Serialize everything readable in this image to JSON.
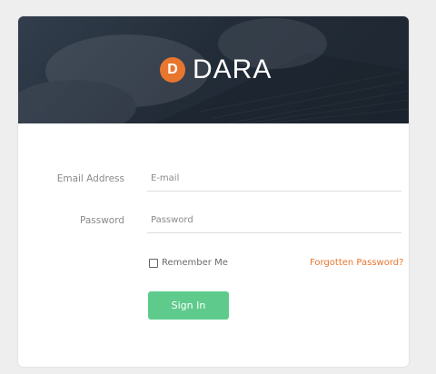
{
  "brand": {
    "logo_letter": "D",
    "name": "DARA",
    "accent": "#e8762f"
  },
  "form": {
    "email_label": "Email Address",
    "email_placeholder": "E-mail",
    "password_label": "Password",
    "password_placeholder": "Password",
    "remember_label": "Remember Me",
    "forgot_link": "Forgotten Password?",
    "signin_label": "Sign In",
    "signin_color": "#5ecb8c"
  }
}
